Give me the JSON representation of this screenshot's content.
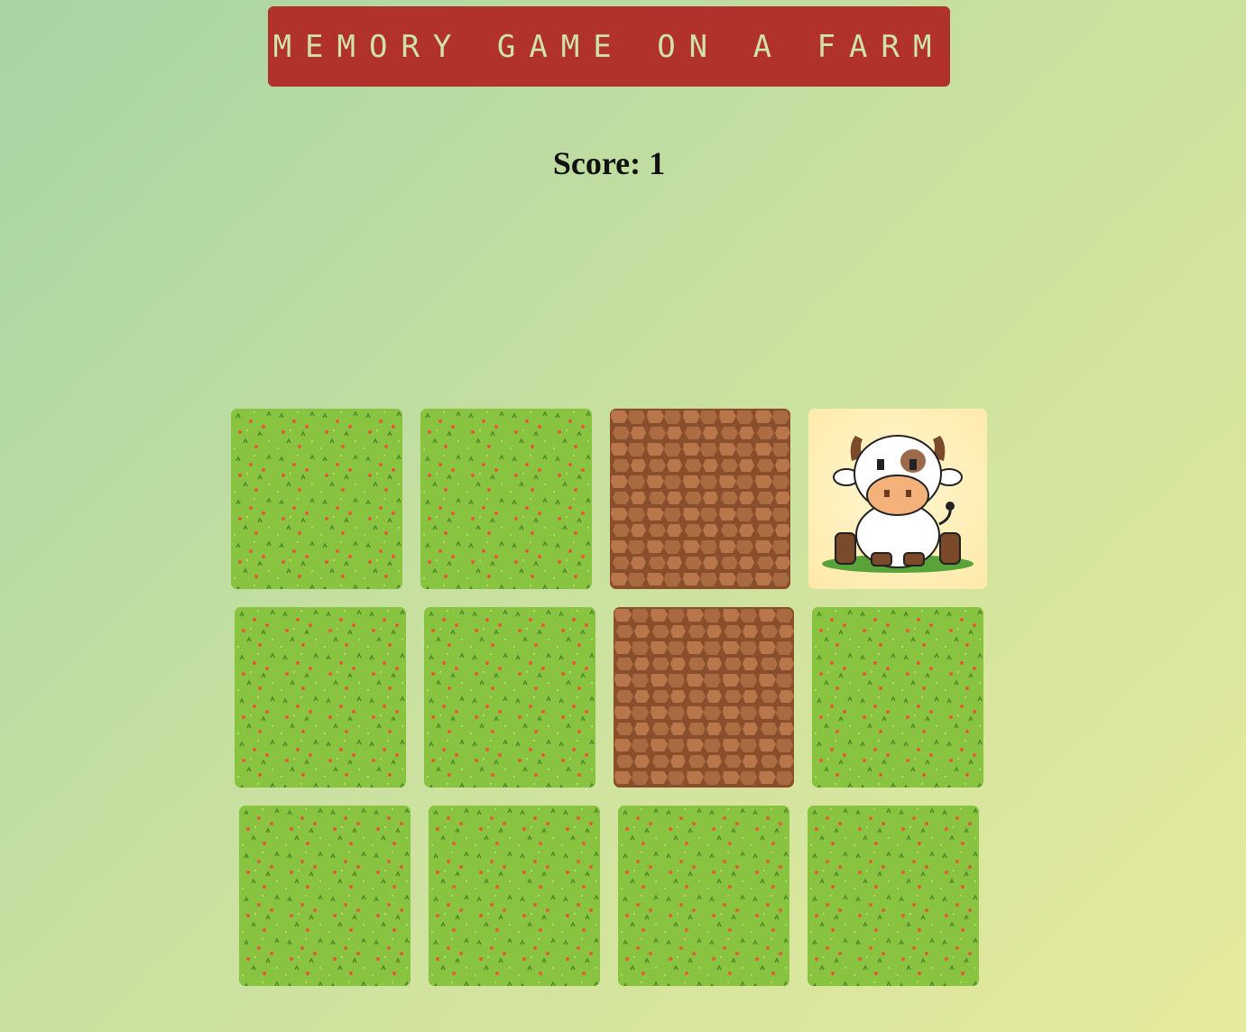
{
  "title": "Memory game on a farm",
  "score": {
    "label": "Score: 1"
  },
  "cards": [
    {
      "state": "hidden"
    },
    {
      "state": "hidden"
    },
    {
      "state": "matched"
    },
    {
      "state": "revealed",
      "content": "cow-icon"
    },
    {
      "state": "hidden"
    },
    {
      "state": "hidden"
    },
    {
      "state": "matched"
    },
    {
      "state": "hidden"
    },
    {
      "state": "hidden"
    },
    {
      "state": "hidden"
    },
    {
      "state": "hidden"
    },
    {
      "state": "hidden"
    }
  ],
  "colors": {
    "banner": "#b0322b",
    "title_text": "#cfe3a8",
    "grass": "#88c440",
    "dirt": "#a8643c",
    "revealed_bg": "#ffe9a8"
  }
}
